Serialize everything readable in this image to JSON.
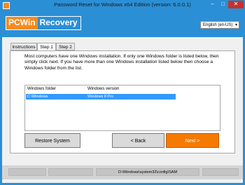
{
  "window": {
    "title": "Password Reset for Windows x64 Edition (version: 6.0.0.1)",
    "controls": {
      "minimize": "–",
      "maximize": "□",
      "close": "✕"
    }
  },
  "header": {
    "logo_part1": "PCWin",
    "logo_part2": "Recovery",
    "language": {
      "selected": "English (en-US)",
      "chevron": "▾"
    }
  },
  "tabs": [
    {
      "label": "Instructions"
    },
    {
      "label": "Step 1"
    },
    {
      "label": "Step 2"
    }
  ],
  "instructions": "Most computers have one Windows installation.  If only one Windows folder is listed below, then simply click next.  If you have more than one Windows installation listed below then choose a Windows folder from the list.",
  "list": {
    "columns": [
      "Windows folder",
      "Windows version"
    ],
    "rows": [
      {
        "folder": "C:\\Windows",
        "version": "Windows 8 Pro"
      }
    ]
  },
  "buttons": {
    "restore": "Restore System",
    "back": "< Back",
    "next": "Next >"
  },
  "status": {
    "path": "D:\\Windows\\system32\\config\\SAM"
  },
  "colors": {
    "accent": "#2b8fd6",
    "orange": "#f57a00",
    "selection": "#3399ff"
  }
}
